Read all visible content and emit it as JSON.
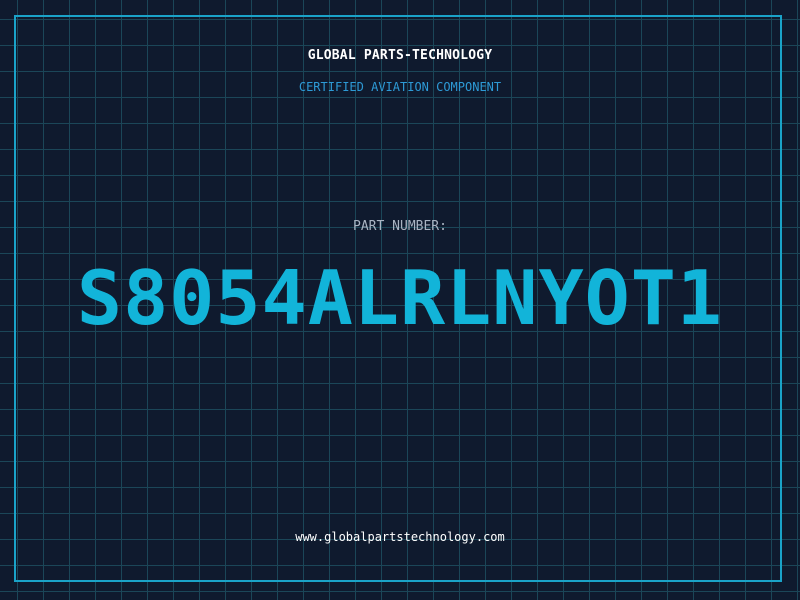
{
  "header": {
    "company_name": "GLOBAL PARTS-TECHNOLOGY",
    "subtitle": "CERTIFIED AVIATION COMPONENT"
  },
  "part": {
    "label": "PART NUMBER:",
    "number": "S8054ALRLNYOT1"
  },
  "footer": {
    "website": "www.globalpartstechnology.com"
  },
  "colors": {
    "background": "#0f1a2e",
    "grid": "#1b4658",
    "accent": "#12b4d9",
    "frame": "#1aa3c9",
    "subtitle": "#2d9ad6"
  }
}
